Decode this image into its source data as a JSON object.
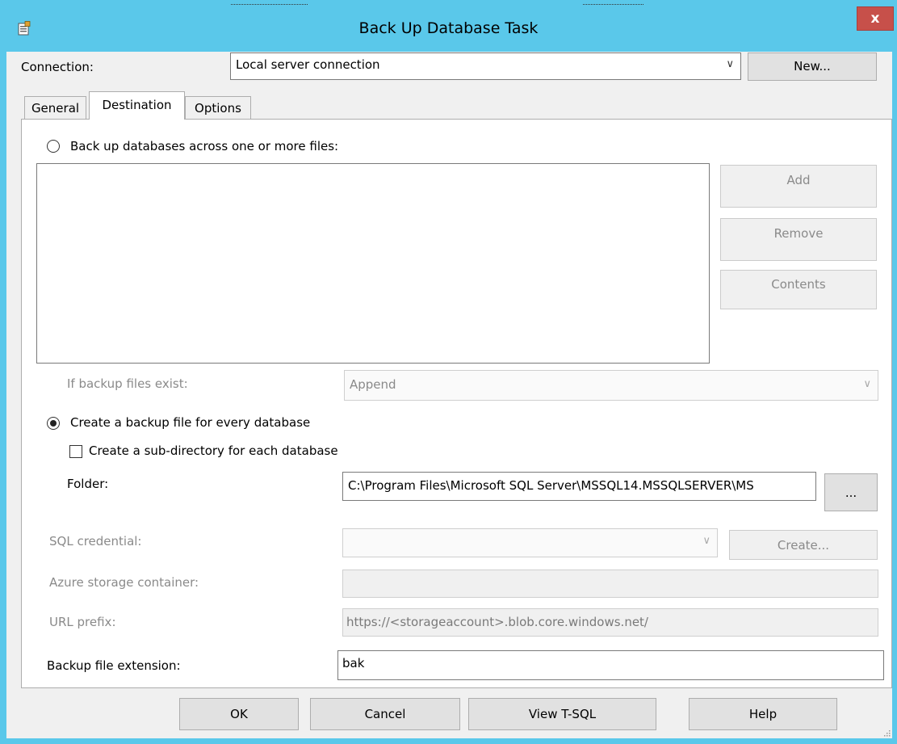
{
  "window": {
    "title": "Back Up Database Task",
    "close_label": "x"
  },
  "connection": {
    "label": "Connection:",
    "value": "Local server connection",
    "new_button": "New..."
  },
  "tabs": [
    {
      "label": "General"
    },
    {
      "label": "Destination"
    },
    {
      "label": "Options"
    }
  ],
  "destination": {
    "radio_across_files": "Back up databases across one or more files:",
    "add_button": "Add",
    "remove_button": "Remove",
    "contents_button": "Contents",
    "if_exists_label": "If backup files exist:",
    "if_exists_value": "Append",
    "radio_every_db": "Create a backup file for every database",
    "subdir_checkbox": "Create a sub-directory for each database",
    "folder_label": "Folder:",
    "folder_value": "C:\\Program Files\\Microsoft SQL Server\\MSSQL14.MSSQLSERVER\\MS",
    "browse_button": "...",
    "sql_credential_label": "SQL credential:",
    "sql_credential_value": "",
    "create_button": "Create...",
    "azure_container_label": "Azure storage container:",
    "azure_container_value": "",
    "url_prefix_label": "URL prefix:",
    "url_prefix_value": "https://<storageaccount>.blob.core.windows.net/",
    "extension_label": "Backup file extension:",
    "extension_value": "bak"
  },
  "footer": {
    "ok": "OK",
    "cancel": "Cancel",
    "view_tsql": "View T-SQL",
    "help": "Help"
  },
  "colors": {
    "titlebar": "#5ac8ea",
    "close": "#c7504a",
    "dialog_bg": "#f0f0f0"
  }
}
